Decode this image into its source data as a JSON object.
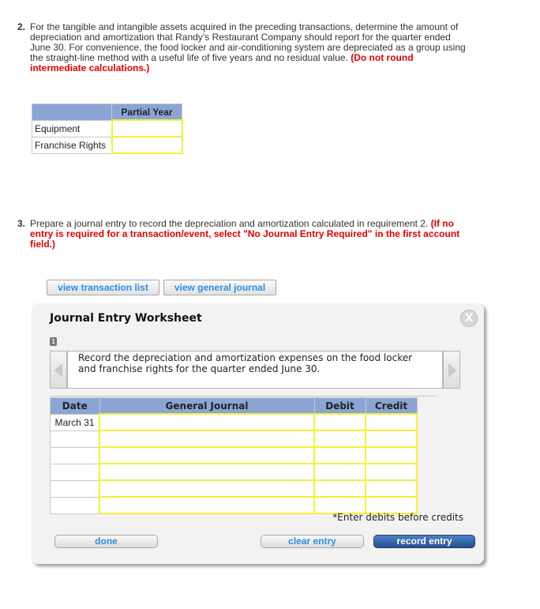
{
  "question2": {
    "number": "2.",
    "text": "For the tangible and intangible assets acquired in the preceding transactions, determine the amount of depreciation and amortization that Randy’s Restaurant Company should report for the quarter ended June 30. For convenience, the food locker and air-conditioning system are depreciated as a group using the straight-line method with a useful life of five years and no residual value.",
    "note": "(Do not round intermediate calculations.)"
  },
  "partial_year_table": {
    "header": "Partial Year",
    "rows": [
      {
        "label": "Equipment",
        "value": ""
      },
      {
        "label": "Franchise Rights",
        "value": ""
      }
    ]
  },
  "question3": {
    "number": "3.",
    "text": "Prepare a journal entry to record the depreciation and amortization calculated in requirement 2.",
    "note": "(If no entry is required for a transaction/event, select \"No Journal Entry Required\" in the first account field.)"
  },
  "top_buttons": {
    "view_transaction_list": "view transaction list",
    "view_general_journal": "view general journal"
  },
  "worksheet": {
    "title": "Journal Entry Worksheet",
    "close_label": "X",
    "step": "1",
    "description": "Record the depreciation and amortization expenses on the food locker and franchise rights for the quarter ended June 30.",
    "columns": [
      "Date",
      "General Journal",
      "Debit",
      "Credit"
    ],
    "rows": [
      {
        "date": "March 31",
        "account": "",
        "debit": "",
        "credit": ""
      },
      {
        "date": "",
        "account": "",
        "debit": "",
        "credit": ""
      },
      {
        "date": "",
        "account": "",
        "debit": "",
        "credit": ""
      },
      {
        "date": "",
        "account": "",
        "debit": "",
        "credit": ""
      },
      {
        "date": "",
        "account": "",
        "debit": "",
        "credit": ""
      },
      {
        "date": "",
        "account": "",
        "debit": "",
        "credit": ""
      }
    ],
    "note": "*Enter debits before credits",
    "buttons": {
      "done": "done",
      "clear_entry": "clear entry",
      "record_entry": "record entry"
    }
  }
}
